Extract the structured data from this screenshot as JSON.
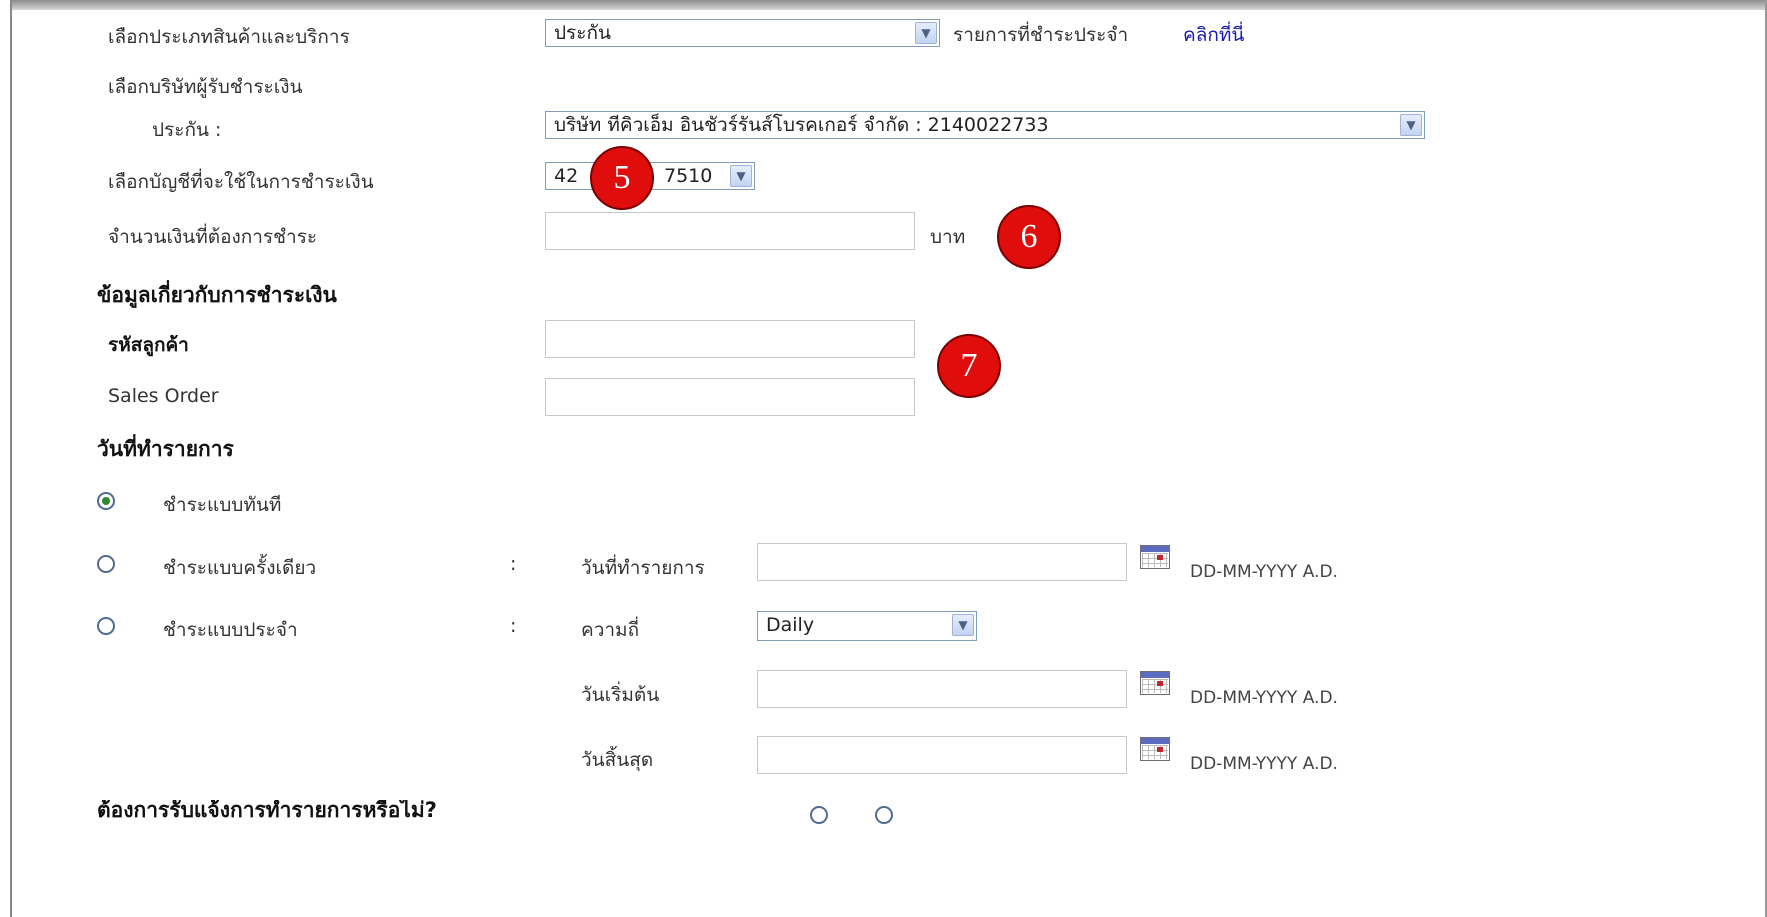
{
  "service_type": {
    "label": "เลือกประเภทสินค้าและบริการ",
    "selected": "ประกัน",
    "recurring_text": "รายการที่ชำระประจำ",
    "recurring_link": "คลิกที่นี่"
  },
  "payee": {
    "label": "เลือกบริษัทผู้รับชำระเงิน",
    "category_label": "ประกัน :",
    "selected": "บริษัท ทีคิวเอ็ม อินชัวร์รันส์โบรคเกอร์ จำกัด : 2140022733"
  },
  "account": {
    "label": "เลือกบัญชีที่จะใช้ในการชำระเงิน",
    "selected_visible_left": "42",
    "selected_visible_right": "7510"
  },
  "amount": {
    "label": "จำนวนเงินที่ต้องการชำระ",
    "unit": "บาท",
    "value": ""
  },
  "payment_info": {
    "heading": "ข้อมูลเกี่ยวกับการชำระเงิน",
    "customer_code_label": "รหัสลูกค้า",
    "customer_code_value": "",
    "sales_order_label": "Sales Order",
    "sales_order_value": ""
  },
  "transaction_date": {
    "heading": "วันที่ทำรายการ",
    "options": [
      {
        "label": "ชำระแบบทันที",
        "selected": true
      },
      {
        "label": "ชำระแบบครั้งเดียว",
        "selected": false
      },
      {
        "label": "ชำระแบบประจำ",
        "selected": false
      }
    ],
    "colon": ":",
    "once_date_label": "วันที่ทำรายการ",
    "frequency_label": "ความถี่",
    "frequency_selected": "Daily",
    "start_label": "วันเริ่มต้น",
    "end_label": "วันสิ้นสุด",
    "date_hint": "DD-MM-YYYY A.D."
  },
  "notify": {
    "heading_partial": "ต้องการรับแจ้งการทำรายการหรือไม่?"
  },
  "markers": [
    "5",
    "6",
    "7"
  ],
  "colors": {
    "marker_red": "#e00d0d",
    "link_blue": "#1a1ab0",
    "radio_selected": "#2d8a2d"
  }
}
